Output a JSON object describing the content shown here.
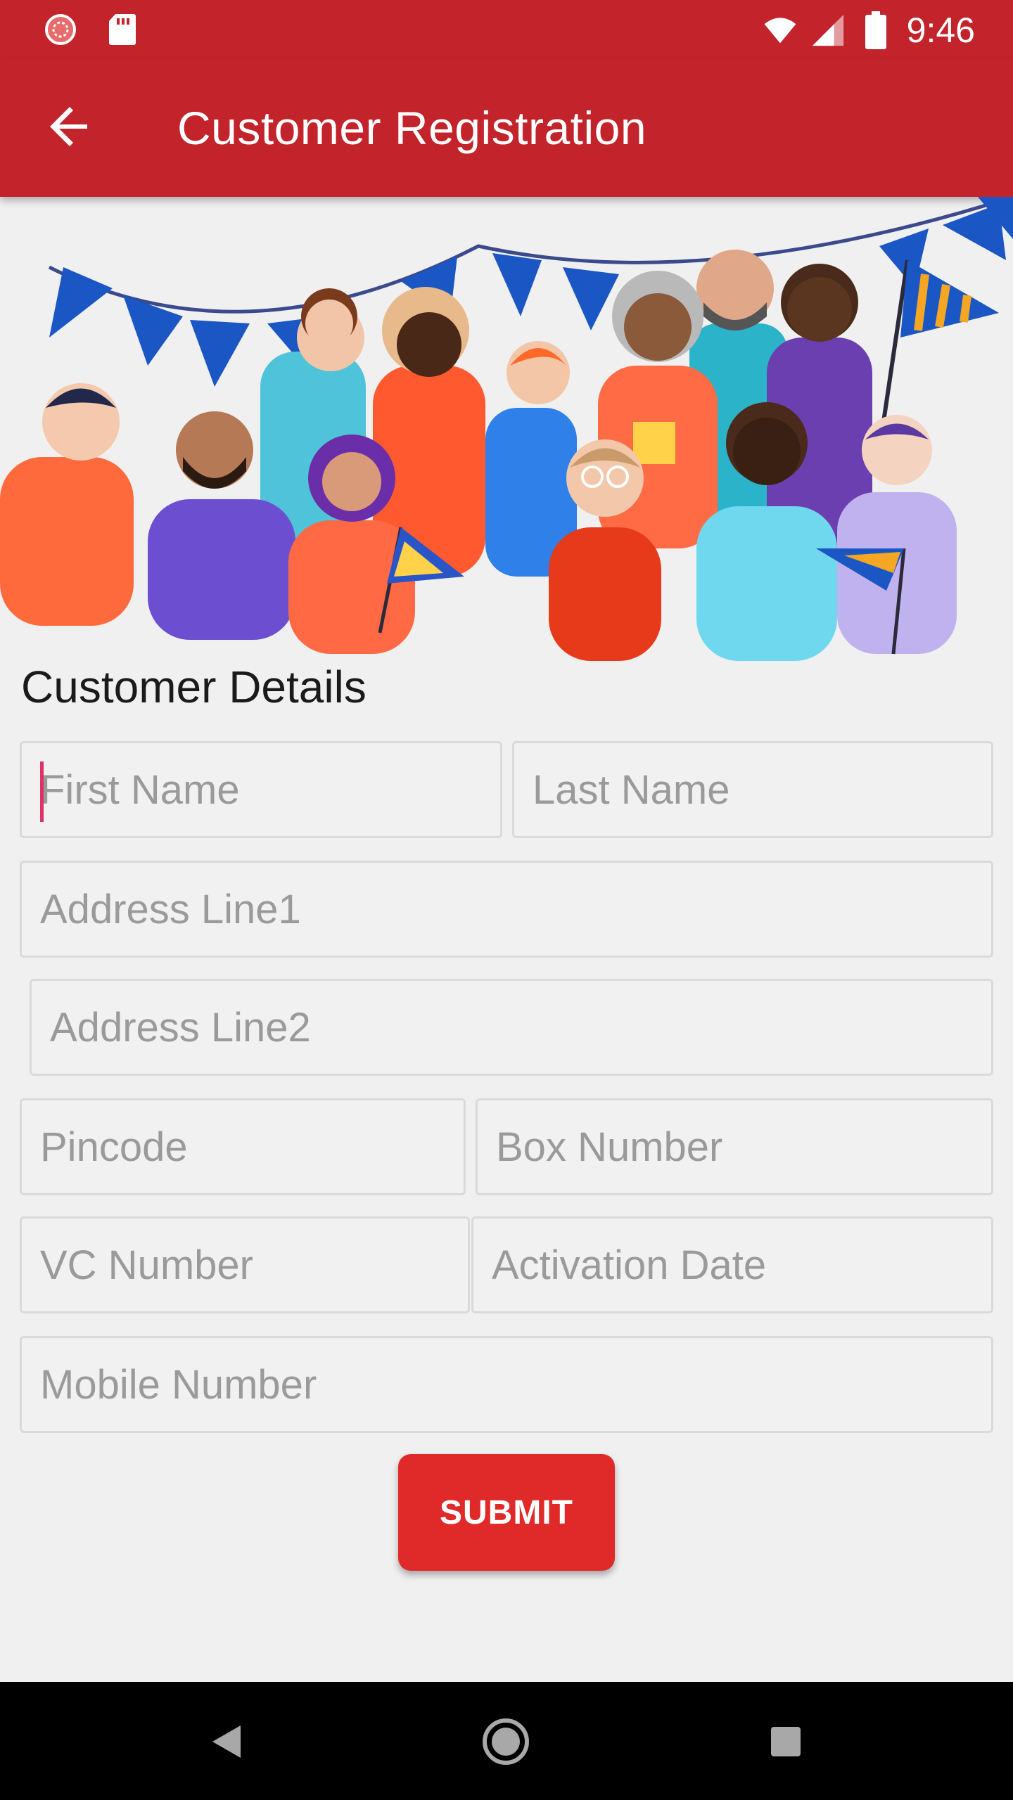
{
  "status_bar": {
    "time": "9:46",
    "icons": [
      "app-notification-icon",
      "sd-card-icon",
      "wifi-icon",
      "signal-icon",
      "battery-icon"
    ]
  },
  "app_bar": {
    "back_icon": "arrow-left-icon",
    "title": "Customer Registration"
  },
  "hero": {
    "illustration": "group-of-people-celebrating"
  },
  "form": {
    "section_title": "Customer Details",
    "fields": {
      "first_name": {
        "value": "",
        "placeholder": "First Name"
      },
      "last_name": {
        "value": "",
        "placeholder": "Last Name"
      },
      "address_line1": {
        "value": "",
        "placeholder": "Address Line1"
      },
      "address_line2": {
        "value": "",
        "placeholder": "Address Line2"
      },
      "pincode": {
        "value": "",
        "placeholder": "Pincode"
      },
      "box_number": {
        "value": "",
        "placeholder": "Box Number"
      },
      "vc_number": {
        "value": "",
        "placeholder": "VC Number"
      },
      "activation_date": {
        "value": "",
        "placeholder": "Activation Date"
      },
      "mobile_number": {
        "value": "",
        "placeholder": "Mobile Number"
      }
    },
    "submit_label": "SUBMIT"
  },
  "nav_bar": {
    "icons": [
      "back-triangle-icon",
      "home-circle-icon",
      "recents-square-icon"
    ]
  },
  "colors": {
    "primary": "#c3232a",
    "accent_button": "#e02a2a",
    "cursor": "#e0306a",
    "background": "#f0f0f0"
  }
}
